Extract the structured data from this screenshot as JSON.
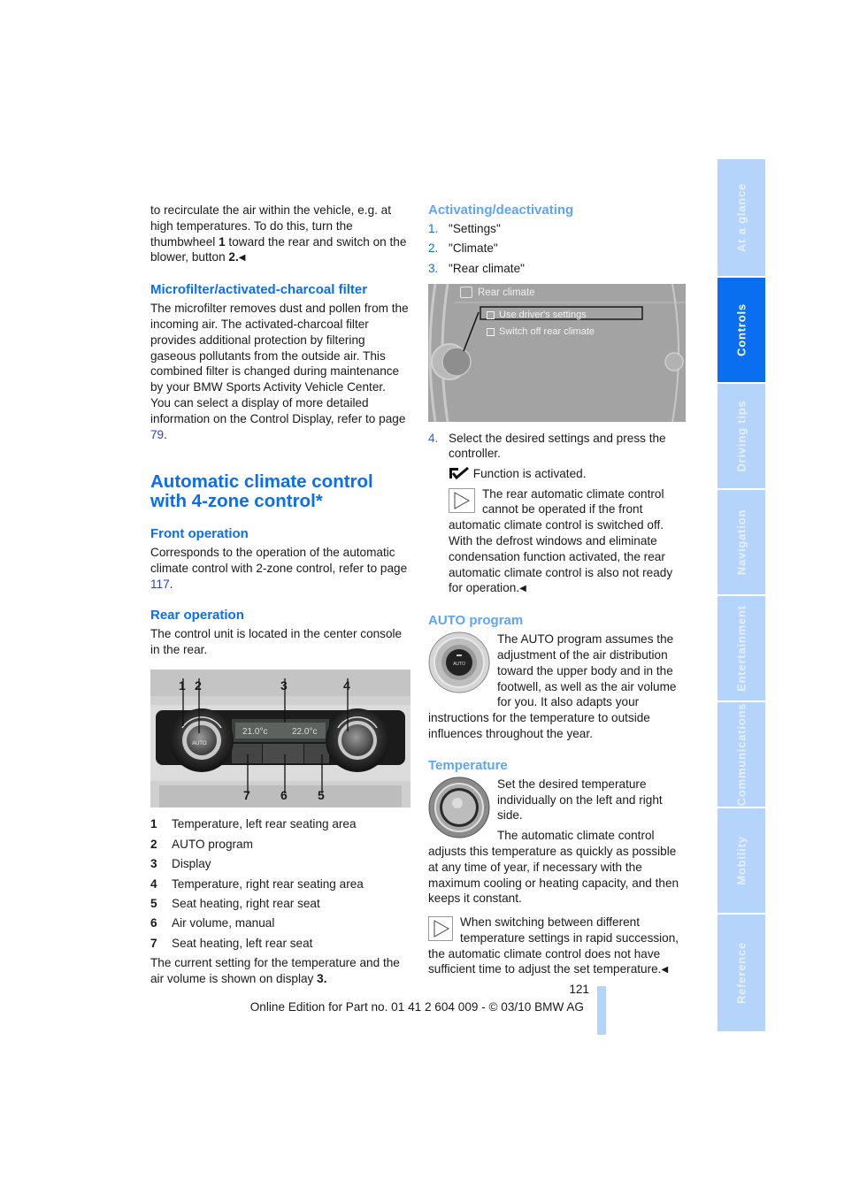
{
  "left_column": {
    "intro_paragraph": {
      "part1": "to recirculate the air within the vehicle, e.g. at high temperatures. To do this, turn the thumbwheel ",
      "bold1": "1",
      "part2": " toward the rear and switch on the blower, button ",
      "bold2": "2.",
      "end_mark": "◀"
    },
    "microfilter": {
      "heading": "Microfilter/activated-charcoal filter",
      "body": "The microfilter removes dust and pollen from the incoming air. The activated-charcoal filter provides additional protection by filtering gaseous pollutants from the outside air. This combined filter is changed during maintenance by your BMW Sports Activity Vehicle Center.",
      "body2_prefix": "You can select a display of more detailed information on the Control Display, refer to page ",
      "body2_link": "79",
      "body2_suffix": "."
    },
    "main_heading_line1": "Automatic climate control",
    "main_heading_line2": "with 4-zone control*",
    "front_operation": {
      "heading": "Front operation",
      "body_prefix": "Corresponds to the operation of the automatic climate control with 2-zone control, refer to page ",
      "link": "117",
      "body_suffix": "."
    },
    "rear_operation": {
      "heading": "Rear operation",
      "body": "The control unit is located in the center console in the rear."
    },
    "control_panel_photo": {
      "callouts_top": [
        "1",
        "2",
        "3",
        "4"
      ],
      "callouts_bottom": [
        "7",
        "6",
        "5"
      ],
      "display_left_temp": "21.0°c",
      "display_right_temp": "22.0°c",
      "button_label": "AUTO"
    },
    "legend": [
      {
        "num": "1",
        "text": "Temperature, left rear seating area"
      },
      {
        "num": "2",
        "text": "AUTO program"
      },
      {
        "num": "3",
        "text": "Display"
      },
      {
        "num": "4",
        "text": "Temperature, right rear seating area"
      },
      {
        "num": "5",
        "text": "Seat heating, right rear seat"
      },
      {
        "num": "6",
        "text": "Air volume, manual"
      },
      {
        "num": "7",
        "text": "Seat heating, left rear seat"
      }
    ],
    "closing_prefix": "The current setting for the temperature and the air volume is shown on display ",
    "closing_bold": "3."
  },
  "right_column": {
    "activating": {
      "heading": "Activating/deactivating",
      "steps": [
        {
          "num": "1.",
          "text": "\"Settings\""
        },
        {
          "num": "2.",
          "text": "\"Climate\""
        },
        {
          "num": "3.",
          "text": "\"Rear climate\""
        }
      ],
      "screen": {
        "title": "Rear climate",
        "options": [
          "Use driver's settings",
          "Switch off rear climate"
        ]
      },
      "step4": {
        "num": "4.",
        "text": "Select the desired settings and press the controller."
      },
      "activated_text": "Function is activated.",
      "note": "The rear automatic climate control cannot be operated if the front automatic climate control is switched off. With the defrost windows and eliminate condensation function activated, the rear automatic climate control is also not ready for operation.",
      "note_end": "◀"
    },
    "auto_program": {
      "heading": "AUTO program",
      "body": "The AUTO program assumes the adjustment of the air distribution toward the upper body and in the footwell, as well as the air volume for you. It also adapts your instructions for the temperature to outside influences throughout the year.",
      "knob_label": "AUTO"
    },
    "temperature": {
      "heading": "Temperature",
      "body1": "Set the desired temperature individually on the left and right side.",
      "body2": "The automatic climate control adjusts this temperature as quickly as possible at any time of year, if necessary with the maximum cooling or heating capacity, and then keeps it constant.",
      "note": "When switching between different temperature settings in rapid succession, the automatic climate control does not have sufficient time to adjust the set temperature.",
      "note_end": "◀"
    }
  },
  "side_tabs": [
    {
      "label": "At a glance",
      "active": false
    },
    {
      "label": "Controls",
      "active": true
    },
    {
      "label": "Driving tips",
      "active": false
    },
    {
      "label": "Navigation",
      "active": false
    },
    {
      "label": "Entertainment",
      "active": false
    },
    {
      "label": "Communications",
      "active": false
    },
    {
      "label": "Mobility",
      "active": false
    },
    {
      "label": "Reference",
      "active": false
    }
  ],
  "footer": {
    "page_number": "121",
    "edition": "Online Edition for Part no. 01 41 2 604 009 - © 03/10 BMW AG"
  },
  "colors": {
    "heading_blue": "#0a6ef0",
    "subheading_lightblue": "#5ea4f7",
    "tab_inactive": "#b5d4fb",
    "tab_active": "#0a6ef0"
  }
}
